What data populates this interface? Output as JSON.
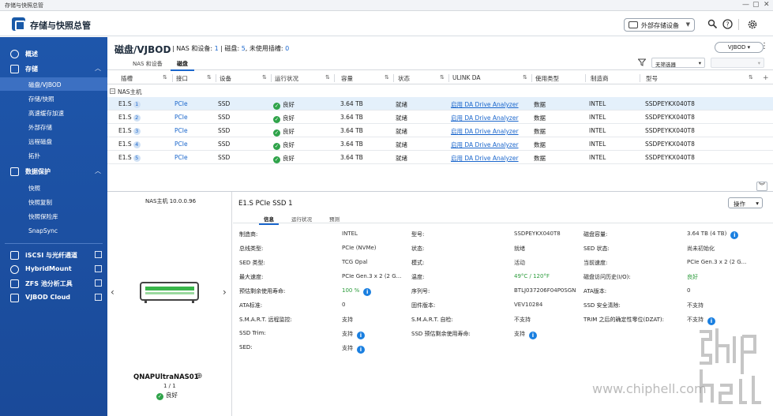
{
  "window": {
    "title": "存储与快照总管",
    "minimize": "—",
    "maximize": "▢",
    "close": "✕"
  },
  "header": {
    "app_title": "存储与快照总管",
    "external_storage_button": "外部存储设备"
  },
  "sidebar": {
    "overview": "概述",
    "storage": "存储",
    "storage_items": [
      "磁盘/VJBOD",
      "存储/快照",
      "高速缓存加速",
      "外部存储",
      "远程磁盘",
      "拓扑"
    ],
    "data_protection": "数据保护",
    "protection_items": [
      "快照",
      "快照复制",
      "快照保险库",
      "SnapSync"
    ],
    "iscsi": "iSCSI 与光纤通道",
    "hybridmount": "HybridMount",
    "zfs": "ZFS 池分析工具",
    "vjbod_cloud": "VJBOD Cloud"
  },
  "page": {
    "title": "磁盘/VJBOD",
    "summary_prefix": "NAS 和设备: ",
    "nas_count": "1",
    "disk_prefix": "磁盘: ",
    "disk_count": "5",
    "unused_prefix": ", 未使用插槽: ",
    "unused_count": "0",
    "vjbod_button": "VJBOD",
    "tabs": [
      "NAS 和设备",
      "磁盘"
    ],
    "filter_placeholder": "无筛选器"
  },
  "table": {
    "columns": [
      "插槽",
      "接口",
      "设备",
      "运行状况",
      "容量",
      "状态",
      "ULINK DA",
      "使用类型",
      "制造商",
      "型号"
    ],
    "group_label": "NAS主机",
    "rows": [
      {
        "slot": "E1.S",
        "num": "1",
        "iface": "PCIe",
        "device": "SSD",
        "health": "良好",
        "capacity": "3.64 TB",
        "status": "就绪",
        "ulink": "启用 DA Drive Analyzer",
        "usage": "数据",
        "maker": "INTEL",
        "model": "SSDPEYKX040T8"
      },
      {
        "slot": "E1.S",
        "num": "2",
        "iface": "PCIe",
        "device": "SSD",
        "health": "良好",
        "capacity": "3.64 TB",
        "status": "就绪",
        "ulink": "启用 DA Drive Analyzer",
        "usage": "数据",
        "maker": "INTEL",
        "model": "SSDPEYKX040T8"
      },
      {
        "slot": "E1.S",
        "num": "3",
        "iface": "PCIe",
        "device": "SSD",
        "health": "良好",
        "capacity": "3.64 TB",
        "status": "就绪",
        "ulink": "启用 DA Drive Analyzer",
        "usage": "数据",
        "maker": "INTEL",
        "model": "SSDPEYKX040T8"
      },
      {
        "slot": "E1.S",
        "num": "4",
        "iface": "PCIe",
        "device": "SSD",
        "health": "良好",
        "capacity": "3.64 TB",
        "status": "就绪",
        "ulink": "启用 DA Drive Analyzer",
        "usage": "数据",
        "maker": "INTEL",
        "model": "SSDPEYKX040T8"
      },
      {
        "slot": "E1.S",
        "num": "5",
        "iface": "PCIe",
        "device": "SSD",
        "health": "良好",
        "capacity": "3.64 TB",
        "status": "就绪",
        "ulink": "启用 DA Drive Analyzer",
        "usage": "数据",
        "maker": "INTEL",
        "model": "SSDPEYKX040T8"
      }
    ]
  },
  "device_panel": {
    "host": "NAS主机 10.0.0.96",
    "name": "QNAPUltraNAS01",
    "page": "1 / 1",
    "state": "良好"
  },
  "detail": {
    "title": "E1.S PCIe SSD 1",
    "action_button": "操作",
    "tabs": [
      "信息",
      "运行状况",
      "预测"
    ],
    "col1": [
      {
        "k": "制造商:",
        "v": "INTEL"
      },
      {
        "k": "总线类型:",
        "v": "PCIe (NVMe)"
      },
      {
        "k": "SED 类型:",
        "v": "TCG Opal"
      },
      {
        "k": "最大速度:",
        "v": "PCIe Gen.3 x 2 (2 G..."
      },
      {
        "k": "预估剩余使用寿命:",
        "v": "100 %"
      },
      {
        "k": "ATA标准:",
        "v": "0"
      },
      {
        "k": "S.M.A.R.T. 远程监控:",
        "v": "支持"
      },
      {
        "k": "SSD Trim:",
        "v": "支持"
      },
      {
        "k": "SED:",
        "v": "支持"
      }
    ],
    "col2": [
      {
        "k": "型号:",
        "v": "SSDPEYKX040T8"
      },
      {
        "k": "状态:",
        "v": "就绪"
      },
      {
        "k": "模式:",
        "v": "活动"
      },
      {
        "k": "温度:",
        "v": "49°C / 120°F"
      },
      {
        "k": "序列号:",
        "v": "BTLJ037206F04P0SGN"
      },
      {
        "k": "固件版本:",
        "v": "VEV10284"
      },
      {
        "k": "S.M.A.R.T. 自检:",
        "v": "不支持"
      },
      {
        "k": "SSD 预估剩余使用寿命:",
        "v": "支持"
      }
    ],
    "col3": [
      {
        "k": "磁盘容量:",
        "v": "3.64 TB (4 TB)"
      },
      {
        "k": "SED 状态:",
        "v": "尚未初始化"
      },
      {
        "k": "当前速度:",
        "v": "PCIe Gen.3 x 2 (2 G..."
      },
      {
        "k": "磁盘访问历史(I/O):",
        "v": "良好"
      },
      {
        "k": "ATA版本:",
        "v": "0"
      },
      {
        "k": "SSD 安全清除:",
        "v": "不支持"
      },
      {
        "k": "TRIM 之后的确定性零位(DZAT):",
        "v": "不支持"
      }
    ]
  },
  "watermark": "www.chiphell.com",
  "colors": {
    "sidebar": "#1e56ab",
    "accent": "#1a66cc",
    "ok": "#2fa34a"
  }
}
